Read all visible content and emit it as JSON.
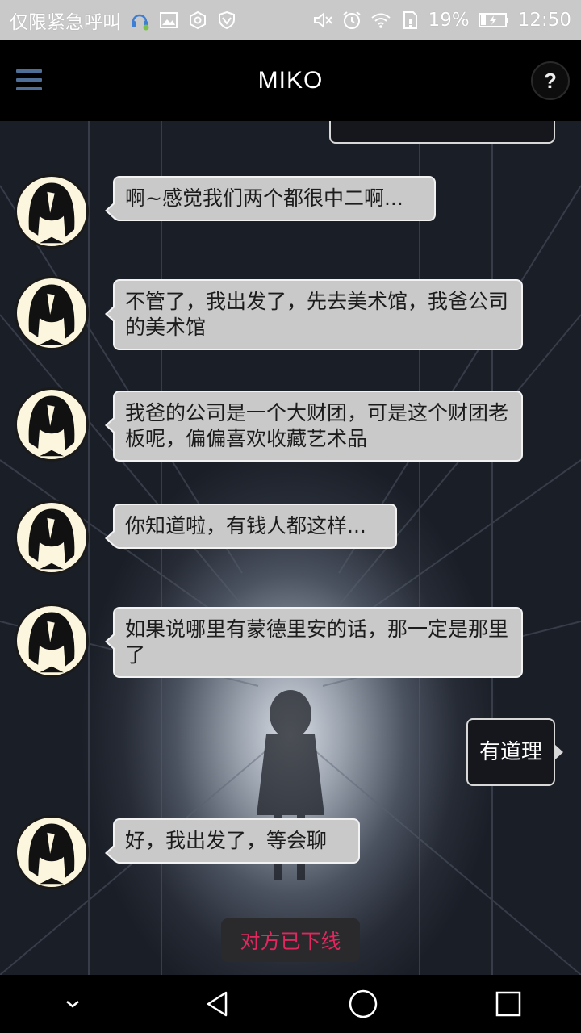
{
  "status_bar": {
    "carrier_text": "仅限紧急呼叫",
    "battery": "19%",
    "time": "12:50",
    "icons": [
      "headset-icon",
      "image-icon",
      "hexagon-icon",
      "shield-icon",
      "mute-icon",
      "alarm-icon",
      "wifi-icon",
      "sim-icon",
      "battery-icon"
    ]
  },
  "header": {
    "title": "MIKO",
    "help_label": "?"
  },
  "messages": [
    {
      "side": "left",
      "text": "啊~感觉我们两个都很中二啊..."
    },
    {
      "side": "left",
      "text": "不管了，我出发了，先去美术馆，我爸公司的美术馆"
    },
    {
      "side": "left",
      "text": "我爸的公司是一个大财团，可是这个财团老板呢，偏偏喜欢收藏艺术品"
    },
    {
      "side": "left",
      "text": "你知道啦，有钱人都这样..."
    },
    {
      "side": "left",
      "text": "如果说哪里有蒙德里安的话，那一定是那里了"
    },
    {
      "side": "right",
      "text": "有道理"
    },
    {
      "side": "left",
      "text": "好，我出发了，等会聊"
    }
  ],
  "notice": {
    "offline": "对方已下线"
  },
  "nav": {
    "icons": [
      "chevron-down-icon",
      "back-icon",
      "home-icon",
      "recents-icon"
    ]
  },
  "colors": {
    "header_bg": "#000000",
    "menu_accent": "#4f6f96",
    "bubble_other": "#c9c9c9",
    "bubble_self": "#15171c",
    "offline_text": "#e0285f"
  }
}
